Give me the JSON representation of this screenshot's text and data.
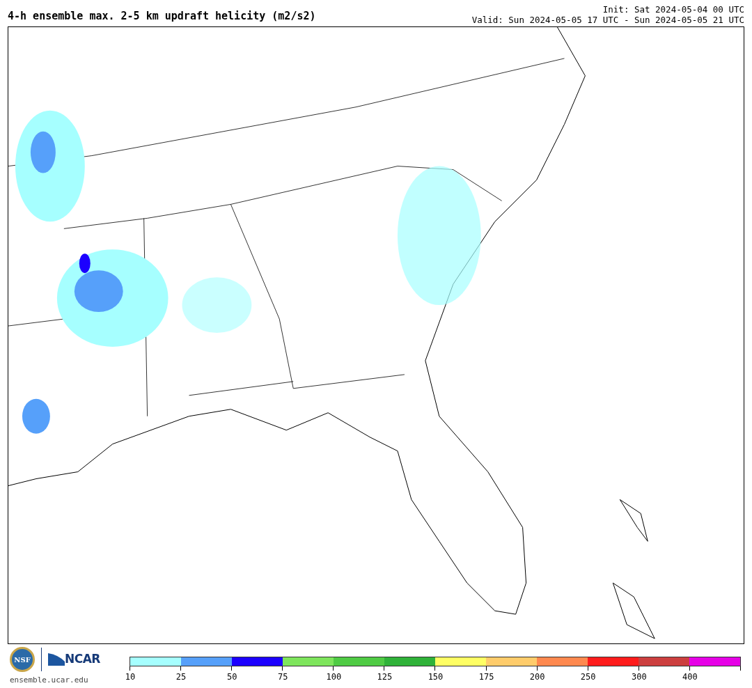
{
  "header": {
    "title": "4-h ensemble max. 2-5 km updraft helicity (m2/s2)",
    "init": "Init: Sat 2024-05-04 00 UTC",
    "valid": "Valid: Sun 2024-05-05 17 UTC - Sun 2024-05-05 21 UTC"
  },
  "logos": {
    "nsf": "NSF",
    "ncar": "NCAR",
    "site": "ensemble.ucar.edu"
  },
  "colorbar": {
    "bins": [
      {
        "color": "#a6ffff",
        "tick": "10"
      },
      {
        "color": "#56a0fa",
        "tick": "25"
      },
      {
        "color": "#1c00ff",
        "tick": "50"
      },
      {
        "color": "#7ee55c",
        "tick": "75"
      },
      {
        "color": "#4fcb44",
        "tick": "100"
      },
      {
        "color": "#2fb239",
        "tick": "125"
      },
      {
        "color": "#ffff64",
        "tick": "150"
      },
      {
        "color": "#ffcc6b",
        "tick": "175"
      },
      {
        "color": "#ff894f",
        "tick": "200"
      },
      {
        "color": "#ff1c1c",
        "tick": "250"
      },
      {
        "color": "#cc3f3f",
        "tick": "300"
      },
      {
        "color": "#e600e6",
        "tick": "400"
      }
    ]
  }
}
